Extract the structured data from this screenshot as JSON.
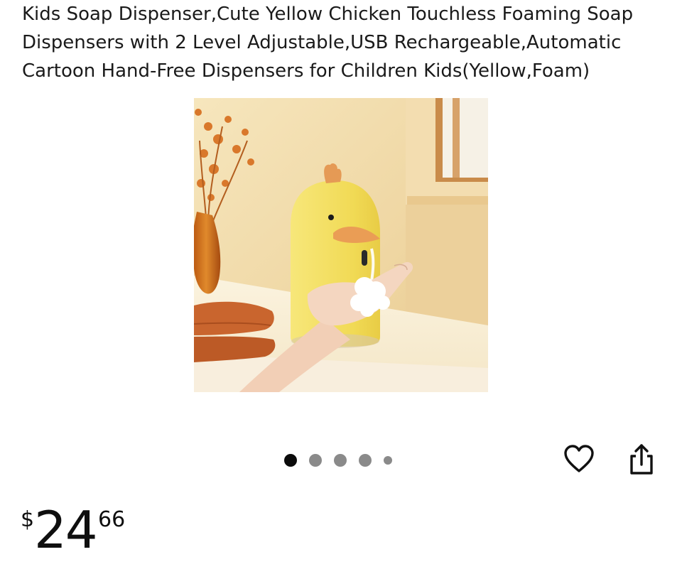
{
  "product": {
    "title": "Kids Soap Dispenser,Cute Yellow Chicken Touchless Foaming Soap Dispensers with 2 Level Adjustable,USB Rechargeable,Automatic Cartoon Hand-Free Dispensers for Children Kids(Yellow,Foam)",
    "image_alt": "Yellow chicken touchless foaming soap dispenser with hand receiving foam",
    "price": {
      "symbol": "$",
      "whole": "24",
      "fraction": "66"
    }
  },
  "carousel": {
    "total_images": 5,
    "active_index": 0
  },
  "actions": {
    "favorite_icon": "heart-outline-icon",
    "share_icon": "share-upload-icon"
  },
  "colors": {
    "dispenser_yellow": "#f3df5a",
    "beak_orange": "#e9a15a",
    "wall_beige": "#f1dcae",
    "towel_orange": "#c9652e",
    "dot_active": "#0b0b0b",
    "dot_inactive": "#8a8a8a"
  }
}
